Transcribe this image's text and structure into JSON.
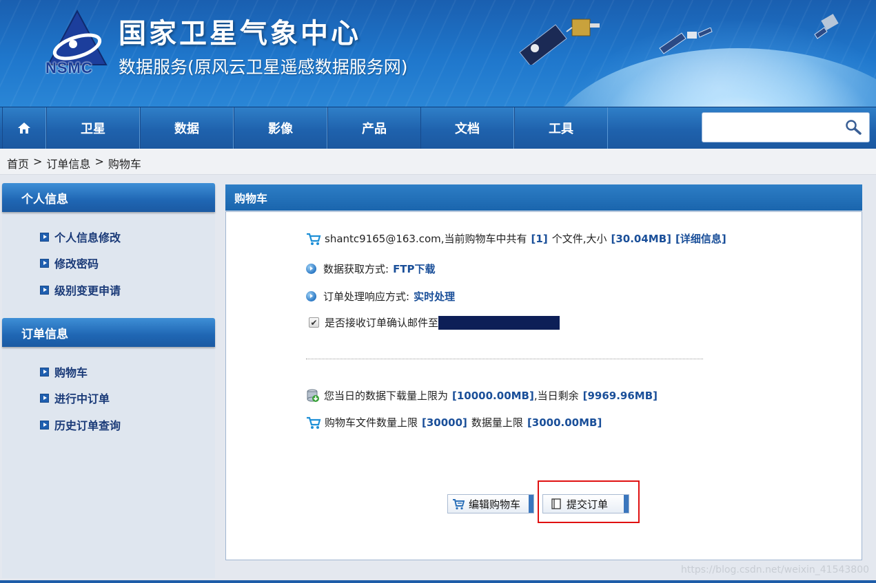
{
  "header": {
    "logo_text": "NSMC",
    "title": "国家卫星气象中心",
    "subtitle": "数据服务(原风云卫星遥感数据服务网)"
  },
  "nav": {
    "home_icon": "home-icon",
    "items": [
      {
        "label": "卫星"
      },
      {
        "label": "数据"
      },
      {
        "label": "影像"
      },
      {
        "label": "产品"
      },
      {
        "label": "文档"
      },
      {
        "label": "工具"
      }
    ],
    "search": {
      "value": "",
      "placeholder": "",
      "icon": "search-icon"
    }
  },
  "breadcrumb": {
    "items": [
      "首页",
      "订单信息",
      "购物车"
    ],
    "separator": ">"
  },
  "sidebar": {
    "sections": [
      {
        "title": "个人信息",
        "items": [
          {
            "label": "个人信息修改"
          },
          {
            "label": "修改密码"
          },
          {
            "label": "级别变更申请"
          }
        ]
      },
      {
        "title": "订单信息",
        "items": [
          {
            "label": "购物车"
          },
          {
            "label": "进行中订单"
          },
          {
            "label": "历史订单查询"
          }
        ]
      }
    ]
  },
  "panel": {
    "title": "购物车",
    "cart_summary": {
      "text_before": "shantc9165@163.com,当前购物车中共有",
      "file_count": "[1]",
      "text_mid": "个文件,大小",
      "size": "[30.04MB]",
      "detail_link": "[详细信息]"
    },
    "fetch_method": {
      "label": "数据获取方式:",
      "value": "FTP下载"
    },
    "response_method": {
      "label": "订单处理响应方式:",
      "value": "实时处理"
    },
    "email_confirm": {
      "label": "是否接收订单确认邮件至",
      "checked": true,
      "check_glyph": "✔"
    },
    "daily_limit": {
      "text_before": "您当日的数据下载量上限为",
      "limit": "[10000.00MB]",
      "text_mid": ",当日剩余",
      "remaining": "[9969.96MB]"
    },
    "cart_limit": {
      "text_before": "购物车文件数量上限",
      "file_limit": "[30000]",
      "text_mid": "数据量上限",
      "size_limit": "[3000.00MB]"
    },
    "buttons": {
      "edit_cart": "编辑购物车",
      "submit_order": "提交订单"
    }
  },
  "watermark": "https://blog.csdn.net/weixin_41543800",
  "colors": {
    "nav_blue": "#1f62ad",
    "link_blue": "#1a4f99",
    "highlight_red": "#e01010"
  }
}
